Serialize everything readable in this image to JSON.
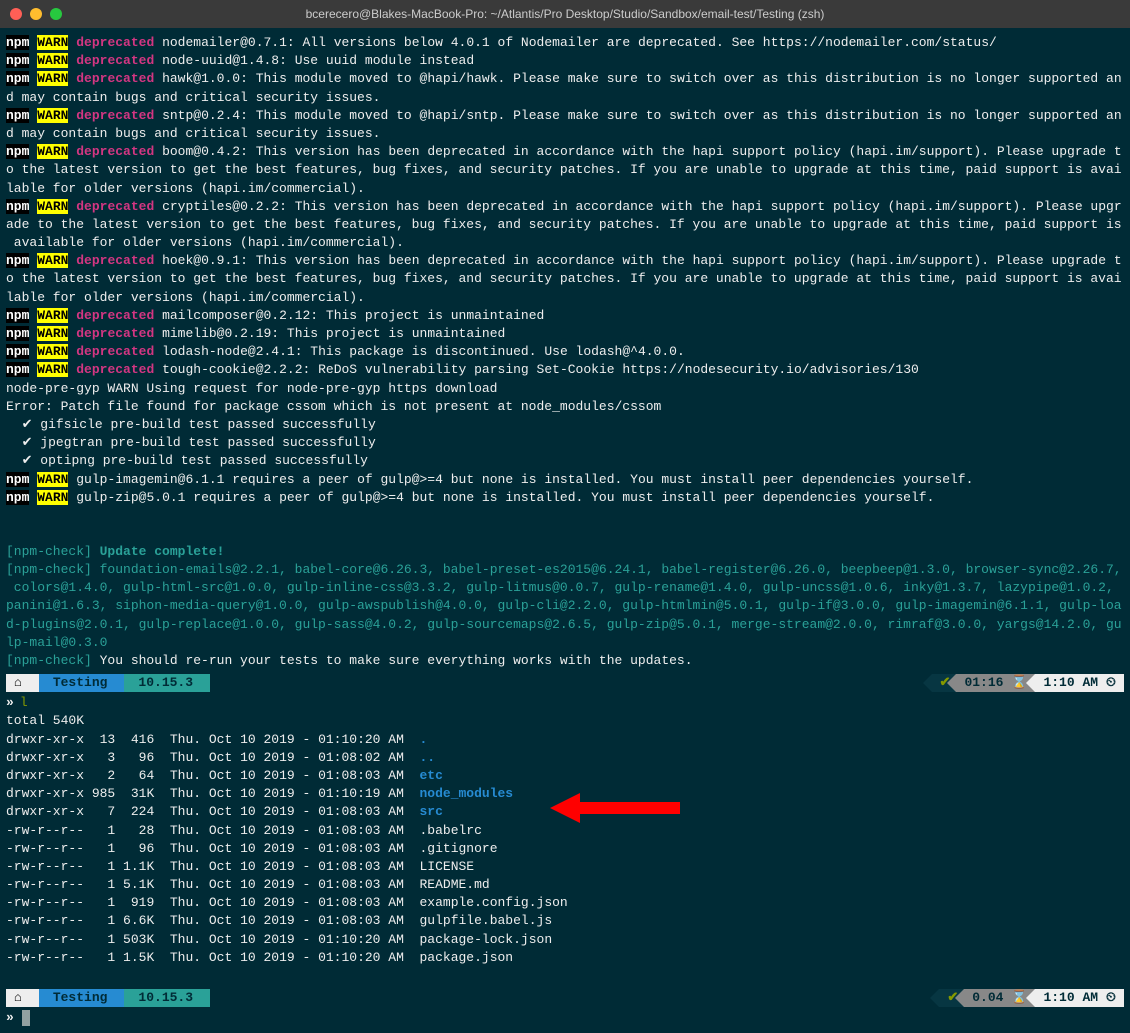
{
  "window": {
    "title": "bcerecero@Blakes-MacBook-Pro: ~/Atlantis/Pro Desktop/Studio/Sandbox/email-test/Testing (zsh)"
  },
  "tags": {
    "npm": "npm",
    "warn": "WARN",
    "deprecated": "deprecated"
  },
  "deprecated": [
    "nodemailer@0.7.1: All versions below 4.0.1 of Nodemailer are deprecated. See https://nodemailer.com/status/",
    "node-uuid@1.4.8: Use uuid module instead",
    "hawk@1.0.0: This module moved to @hapi/hawk. Please make sure to switch over as this distribution is no longer supported and may contain bugs and critical security issues.",
    "sntp@0.2.4: This module moved to @hapi/sntp. Please make sure to switch over as this distribution is no longer supported and may contain bugs and critical security issues.",
    "boom@0.4.2: This version has been deprecated in accordance with the hapi support policy (hapi.im/support). Please upgrade to the latest version to get the best features, bug fixes, and security patches. If you are unable to upgrade at this time, paid support is available for older versions (hapi.im/commercial).",
    "cryptiles@0.2.2: This version has been deprecated in accordance with the hapi support policy (hapi.im/support). Please upgrade to the latest version to get the best features, bug fixes, and security patches. If you are unable to upgrade at this time, paid support is available for older versions (hapi.im/commercial).",
    "hoek@0.9.1: This version has been deprecated in accordance with the hapi support policy (hapi.im/support). Please upgrade to the latest version to get the best features, bug fixes, and security patches. If you are unable to upgrade at this time, paid support is available for older versions (hapi.im/commercial).",
    "mailcomposer@0.2.12: This project is unmaintained",
    "mimelib@0.2.19: This project is unmaintained",
    "lodash-node@2.4.1: This package is discontinued. Use lodash@^4.0.0.",
    "tough-cookie@2.2.2: ReDoS vulnerability parsing Set-Cookie https://nodesecurity.io/advisories/130"
  ],
  "misc": {
    "nodepregyp": "node-pre-gyp WARN Using request for node-pre-gyp https download",
    "cssom": "Error: Patch file found for package cssom which is not present at node_modules/cssom",
    "gifsicle": "  ✔ gifsicle pre-build test passed successfully",
    "jpegtran": "  ✔ jpegtran pre-build test passed successfully",
    "optipng": "  ✔ optipng pre-build test passed successfully"
  },
  "peer": [
    "gulp-imagemin@6.1.1 requires a peer of gulp@>=4 but none is installed. You must install peer dependencies yourself.",
    "gulp-zip@5.0.1 requires a peer of gulp@>=4 but none is installed. You must install peer dependencies yourself."
  ],
  "npmcheck": {
    "tag": "[npm-check]",
    "complete": "Update complete!",
    "packages": "foundation-emails@2.2.1, babel-core@6.26.3, babel-preset-es2015@6.24.1, babel-register@6.26.0, beepbeep@1.3.0, browser-sync@2.26.7, colors@1.4.0, gulp-html-src@1.0.0, gulp-inline-css@3.3.2, gulp-litmus@0.0.7, gulp-rename@1.4.0, gulp-uncss@1.0.6, inky@1.3.7, lazypipe@1.0.2, panini@1.6.3, siphon-media-query@1.0.0, gulp-awspublish@4.0.0, gulp-cli@2.2.0, gulp-htmlmin@5.0.1, gulp-if@3.0.0, gulp-imagemin@6.1.1, gulp-load-plugins@2.0.1, gulp-replace@1.0.0, gulp-sass@4.0.2, gulp-sourcemaps@2.6.5, gulp-zip@5.0.1, merge-stream@2.0.0, rimraf@3.0.0, yargs@14.2.0, gulp-mail@0.3.0",
    "rerun": "You should re-run your tests to make sure everything works with the updates."
  },
  "prompt": {
    "home": "⌂",
    "dir": "Testing",
    "version": "10.15.3",
    "check": "✔",
    "dur1": "01:16 ⌛",
    "dur2": "0.04 ⌛",
    "time": "1:10 AM ⏲",
    "arrow": "»",
    "cmd": "l"
  },
  "ls": {
    "total": "total 540K",
    "rows": [
      {
        "perm": "drwxr-xr-x",
        "n": "13",
        "sz": " 416",
        "dt": "Thu. Oct 10 2019 - 01:10:20 AM",
        "name": ".",
        "type": "dir"
      },
      {
        "perm": "drwxr-xr-x",
        "n": " 3",
        "sz": "  96",
        "dt": "Thu. Oct 10 2019 - 01:08:02 AM",
        "name": "..",
        "type": "dir"
      },
      {
        "perm": "drwxr-xr-x",
        "n": " 2",
        "sz": "  64",
        "dt": "Thu. Oct 10 2019 - 01:08:03 AM",
        "name": "etc",
        "type": "dir"
      },
      {
        "perm": "drwxr-xr-x",
        "n": "985",
        "sz": " 31K",
        "dt": "Thu. Oct 10 2019 - 01:10:19 AM",
        "name": "node_modules",
        "type": "dir"
      },
      {
        "perm": "drwxr-xr-x",
        "n": " 7",
        "sz": " 224",
        "dt": "Thu. Oct 10 2019 - 01:08:03 AM",
        "name": "src",
        "type": "dir"
      },
      {
        "perm": "-rw-r--r--",
        "n": " 1",
        "sz": "  28",
        "dt": "Thu. Oct 10 2019 - 01:08:03 AM",
        "name": ".babelrc",
        "type": "file"
      },
      {
        "perm": "-rw-r--r--",
        "n": " 1",
        "sz": "  96",
        "dt": "Thu. Oct 10 2019 - 01:08:03 AM",
        "name": ".gitignore",
        "type": "file"
      },
      {
        "perm": "-rw-r--r--",
        "n": " 1",
        "sz": "1.1K",
        "dt": "Thu. Oct 10 2019 - 01:08:03 AM",
        "name": "LICENSE",
        "type": "file"
      },
      {
        "perm": "-rw-r--r--",
        "n": " 1",
        "sz": "5.1K",
        "dt": "Thu. Oct 10 2019 - 01:08:03 AM",
        "name": "README.md",
        "type": "file"
      },
      {
        "perm": "-rw-r--r--",
        "n": " 1",
        "sz": " 919",
        "dt": "Thu. Oct 10 2019 - 01:08:03 AM",
        "name": "example.config.json",
        "type": "file"
      },
      {
        "perm": "-rw-r--r--",
        "n": " 1",
        "sz": "6.6K",
        "dt": "Thu. Oct 10 2019 - 01:08:03 AM",
        "name": "gulpfile.babel.js",
        "type": "file"
      },
      {
        "perm": "-rw-r--r--",
        "n": " 1",
        "sz": "503K",
        "dt": "Thu. Oct 10 2019 - 01:10:20 AM",
        "name": "package-lock.json",
        "type": "file"
      },
      {
        "perm": "-rw-r--r--",
        "n": " 1",
        "sz": "1.5K",
        "dt": "Thu. Oct 10 2019 - 01:10:20 AM",
        "name": "package.json",
        "type": "file"
      }
    ]
  },
  "annotation": {
    "target": "node_modules"
  }
}
